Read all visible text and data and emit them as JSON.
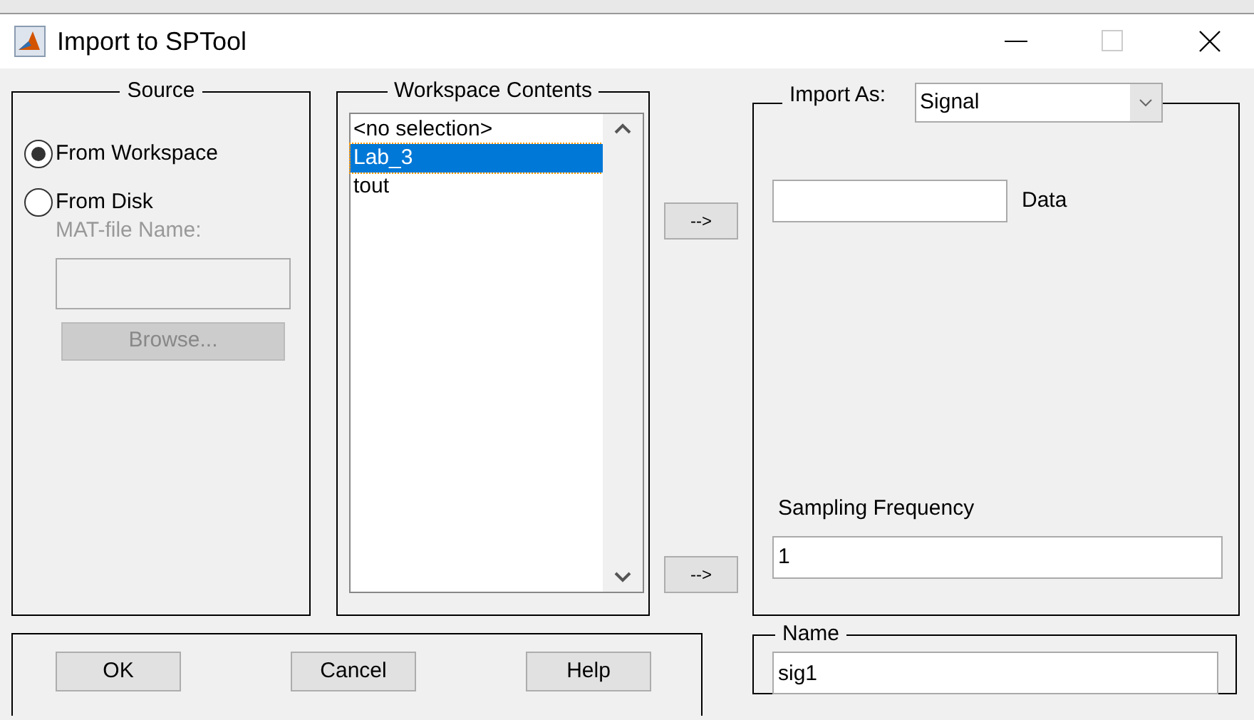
{
  "window": {
    "title": "Import to SPTool"
  },
  "source": {
    "title": "Source",
    "options": [
      {
        "label": "From Workspace",
        "selected": true
      },
      {
        "label": "From Disk",
        "selected": false
      }
    ],
    "mat_file": {
      "label": "MAT-file Name:",
      "disabled": true
    },
    "browse_button": {
      "label": "Browse...",
      "disabled": true
    }
  },
  "workspace": {
    "title": "Workspace Contents",
    "items": [
      {
        "label": "<no selection>",
        "selected": false
      },
      {
        "label": "Lab_3",
        "selected": true
      },
      {
        "label": "tout",
        "selected": false
      }
    ]
  },
  "arrow_buttons": [
    "-->",
    "-->"
  ],
  "import": {
    "label": "Import As:",
    "type": "Signal",
    "data_label": "Data",
    "sampling_label": "Sampling Frequency",
    "sampling_value": "1"
  },
  "buttons": [
    "OK",
    "Cancel",
    "Help"
  ],
  "name": {
    "title": "Name",
    "value": "sig1"
  }
}
